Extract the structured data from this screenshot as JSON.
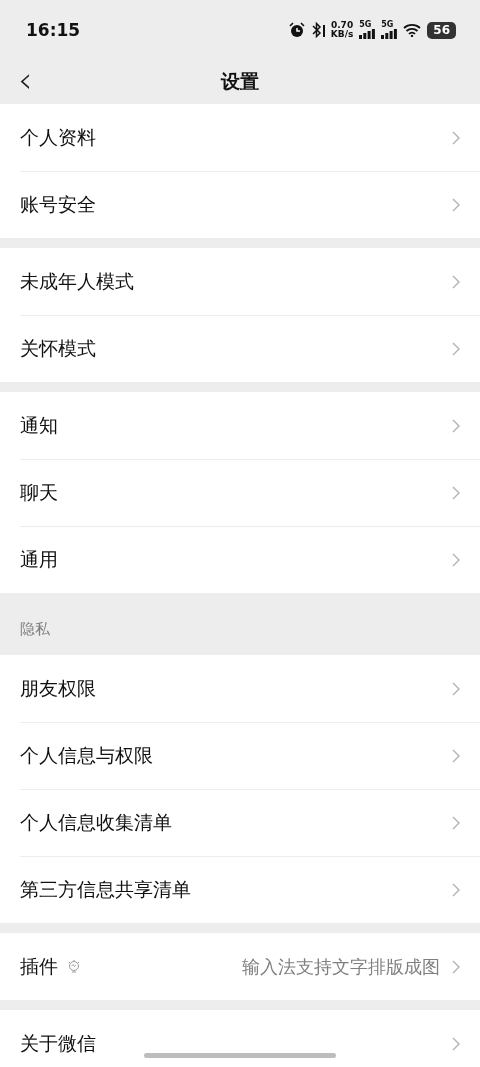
{
  "status_bar": {
    "time": "16:15",
    "speed": "0.70",
    "speed_unit": "KB/s",
    "networks": [
      "5G",
      "5G"
    ],
    "battery": "56"
  },
  "nav": {
    "back": "‹",
    "title": "设置"
  },
  "sections": [
    {
      "items": [
        {
          "label": "个人资料",
          "kind": "plain"
        },
        {
          "label": "账号安全",
          "kind": "plain"
        }
      ]
    },
    {
      "items": [
        {
          "label": "未成年人模式",
          "kind": "plain"
        },
        {
          "label": "关怀模式",
          "kind": "plain"
        }
      ]
    },
    {
      "items": [
        {
          "label": "通知",
          "kind": "plain"
        },
        {
          "label": "聊天",
          "kind": "plain"
        },
        {
          "label": "通用",
          "kind": "plain"
        }
      ]
    },
    {
      "header": "隐私",
      "items": [
        {
          "label": "朋友权限",
          "kind": "plain"
        },
        {
          "label": "个人信息与权限",
          "kind": "plain"
        },
        {
          "label": "个人信息收集清单",
          "kind": "plain"
        },
        {
          "label": "第三方信息共享清单",
          "kind": "plain"
        }
      ]
    },
    {
      "items": [
        {
          "label": "插件",
          "kind": "plugin",
          "value": "输入法支持文字排版成图"
        }
      ]
    },
    {
      "items": [
        {
          "label": "关于微信",
          "kind": "plain"
        }
      ]
    }
  ]
}
